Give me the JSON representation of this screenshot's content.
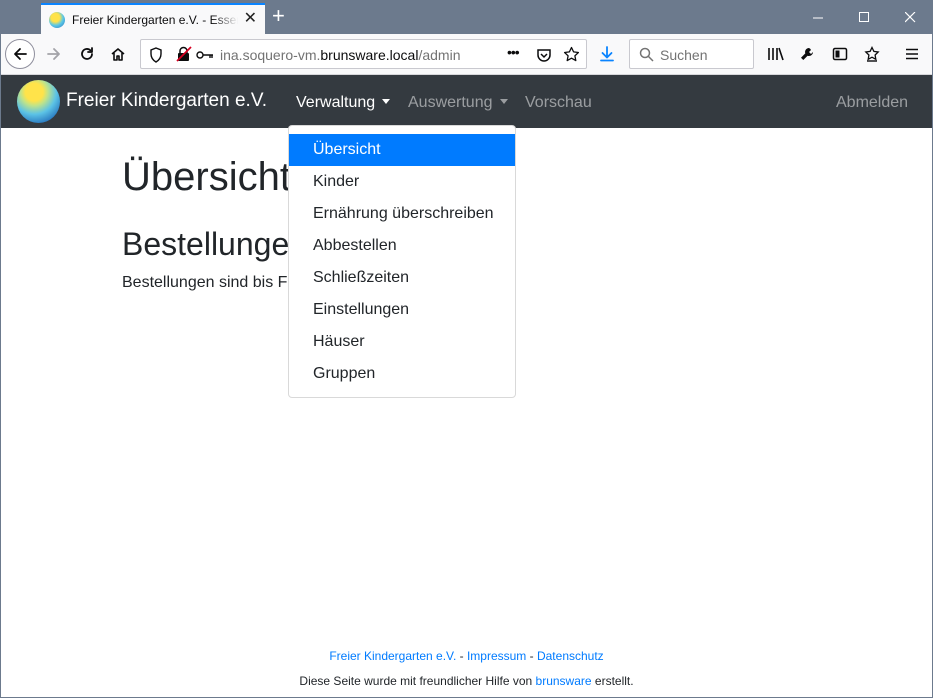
{
  "browser": {
    "tab_title": "Freier Kindergarten e.V. - Essensbestellung",
    "url_prefix": "ina.soquero-vm.",
    "url_host": "brunsware.local",
    "url_path": "/admin",
    "search_placeholder": "Suchen",
    "url_more": "•••"
  },
  "site": {
    "brand": "Freier Kindergarten e.V.",
    "nav": {
      "verwaltung": "Verwaltung",
      "auswertung": "Auswertung",
      "vorschau": "Vorschau",
      "abmelden": "Abmelden"
    }
  },
  "main": {
    "title": "Übersicht",
    "section_title": "Bestellungen",
    "section_text": "Bestellungen sind bis Fe"
  },
  "dropdown": {
    "items": [
      "Übersicht",
      "Kinder",
      "Ernährung überschreiben",
      "Abbestellen",
      "Schließzeiten",
      "Einstellungen",
      "Häuser",
      "Gruppen"
    ]
  },
  "footer": {
    "link1": "Freier Kindergarten e.V.",
    "sep1": " - ",
    "link2": "Impressum",
    "sep2": " - ",
    "link3": "Datenschutz",
    "credit_before": "Diese Seite wurde mit freundlicher Hilfe von ",
    "credit_link": "brunsware",
    "credit_after": " erstellt."
  },
  "colors": {
    "site_nav_bg": "#343a40",
    "accent": "#007bff",
    "browser_titlebar": "#6c7a8d",
    "firefox_blue": "#0a84ff"
  }
}
